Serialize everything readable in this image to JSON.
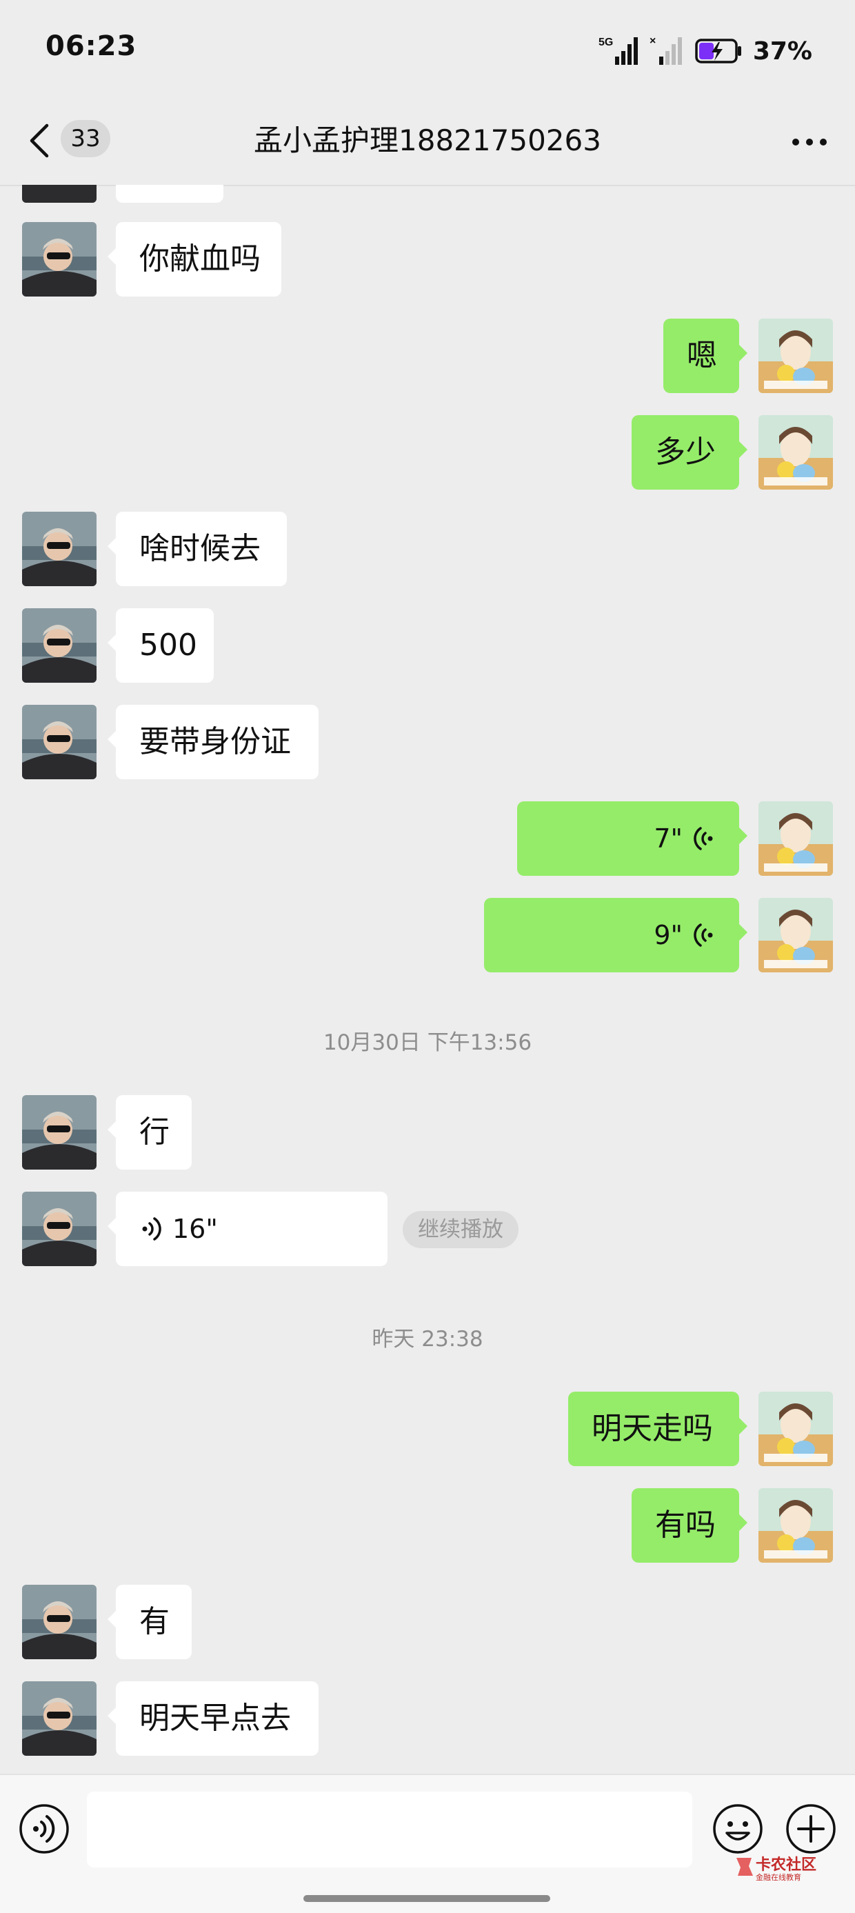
{
  "status_bar": {
    "time": "06:23",
    "network_label": "5G",
    "battery_percent": "37%",
    "battery_level": 0.37
  },
  "header": {
    "unread_count": "33",
    "title": "孟小孟护理18821750263"
  },
  "messages": [
    {
      "side": "left",
      "type": "text",
      "text": "你献血吗"
    },
    {
      "side": "right",
      "type": "text",
      "text": "嗯"
    },
    {
      "side": "right",
      "type": "text",
      "text": "多少"
    },
    {
      "side": "left",
      "type": "text",
      "text": "啥时候去"
    },
    {
      "side": "left",
      "type": "text",
      "text": "500"
    },
    {
      "side": "left",
      "type": "text",
      "text": "要带身份证"
    },
    {
      "side": "right",
      "type": "voice",
      "duration": "7\""
    },
    {
      "side": "right",
      "type": "voice",
      "duration": "9\""
    },
    {
      "type": "timestamp",
      "text": "10月30日 下午13:56"
    },
    {
      "side": "left",
      "type": "text",
      "text": "行"
    },
    {
      "side": "left",
      "type": "voice",
      "duration": "16\"",
      "hint": "继续播放"
    },
    {
      "type": "timestamp",
      "text": "昨天 23:38"
    },
    {
      "side": "right",
      "type": "text",
      "text": "明天走吗"
    },
    {
      "side": "right",
      "type": "text",
      "text": "有吗"
    },
    {
      "side": "left",
      "type": "text",
      "text": "有"
    },
    {
      "side": "left",
      "type": "text",
      "text": "明天早点去"
    }
  ],
  "input_bar": {
    "text_value": "",
    "watermark_name": "卡农社区",
    "watermark_sub": "金融在线教育"
  },
  "icons": {
    "back": "chevron-left-icon",
    "more": "more-dots-icon",
    "voice_mode": "voice-input-icon",
    "emoji": "emoji-icon",
    "plus": "plus-icon"
  },
  "colors": {
    "background": "#ededed",
    "self_bubble": "#95ec69",
    "other_bubble": "#ffffff",
    "timestamp_text": "#8d8d8d",
    "battery_fill": "#7b2ff7"
  }
}
